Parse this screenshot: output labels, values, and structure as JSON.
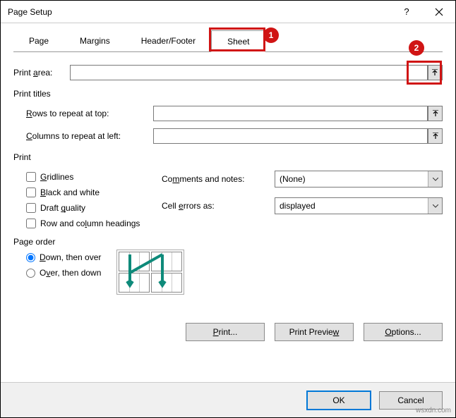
{
  "title": "Page Setup",
  "tabs": {
    "page": "Page",
    "margins": "Margins",
    "headerfooter": "Header/Footer",
    "sheet": "Sheet"
  },
  "badges": {
    "one": "1",
    "two": "2"
  },
  "labels": {
    "printarea": "Print area:",
    "printtitles": "Print titles",
    "rowsrepeat": "Rows to repeat at top:",
    "colsrepeat": "Columns to repeat at left:",
    "print": "Print",
    "gridlines": "Gridlines",
    "bw": "Black and white",
    "draft": "Draft quality",
    "rowcolhead": "Row and column headings",
    "comments": "Comments and notes:",
    "cellerrors": "Cell errors as:",
    "pageorder": "Page order",
    "downover": "Down, then over",
    "overdown": "Over, then down"
  },
  "dropdowns": {
    "comments": "(None)",
    "cellerrors": "displayed"
  },
  "buttons": {
    "print": "Print...",
    "preview": "Print Preview",
    "options": "Options...",
    "ok": "OK",
    "cancel": "Cancel"
  },
  "watermark": "wsxdn.com"
}
